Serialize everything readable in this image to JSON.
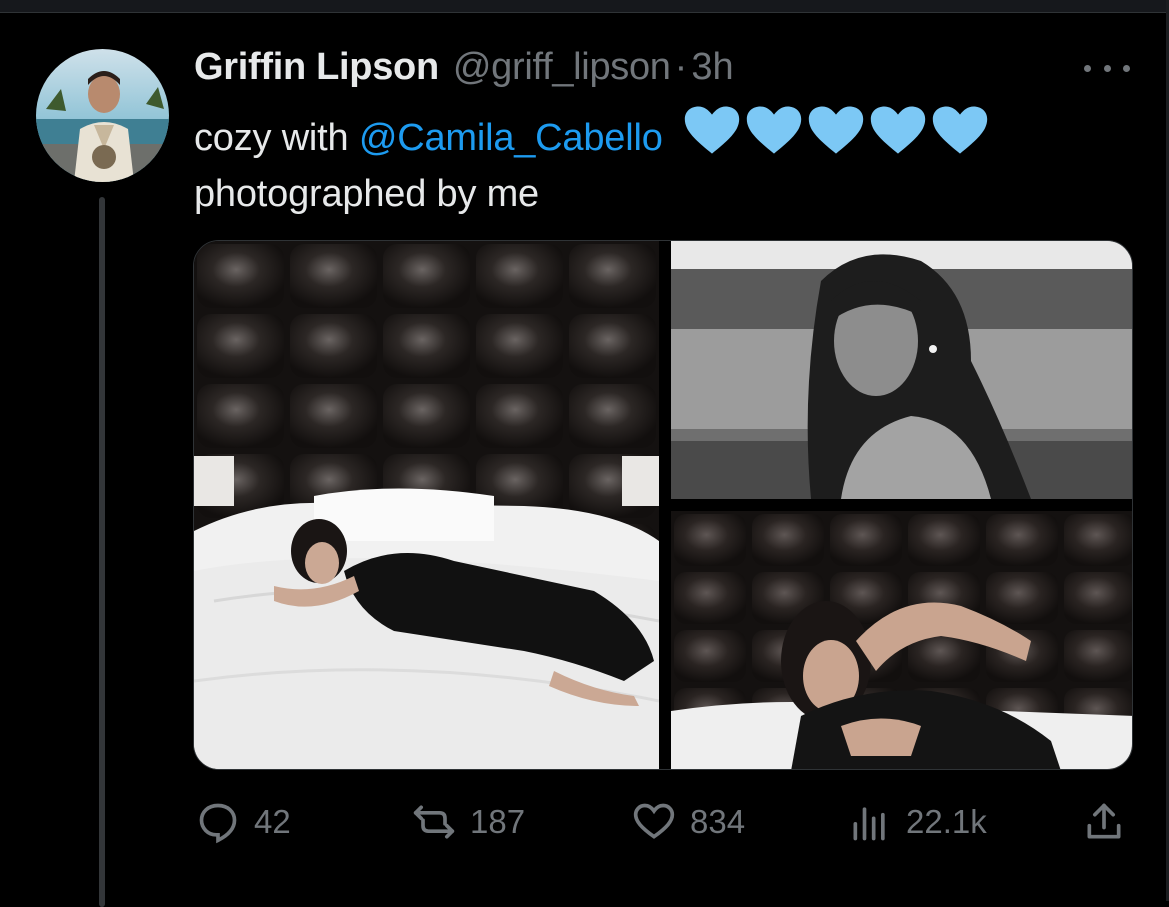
{
  "tweet": {
    "author_name": "Griffin Lipson",
    "handle": "@griff_lipson",
    "separator": "·",
    "time": "3h",
    "text_prefix": "cozy with",
    "mention": "@Camila_Cabello",
    "hearts": [
      "light-blue-heart",
      "light-blue-heart",
      "light-blue-heart",
      "light-blue-heart",
      "light-blue-heart"
    ],
    "text_line2": "photographed by me"
  },
  "media": [
    {
      "name": "bedroom-photo-left",
      "icon": "photo"
    },
    {
      "name": "portrait-photo-top-right",
      "icon": "photo"
    },
    {
      "name": "bedroom-photo-bottom-right",
      "icon": "photo"
    }
  ],
  "actions": {
    "replies": "42",
    "reposts": "187",
    "likes": "834",
    "views": "22.1k"
  },
  "colors": {
    "background": "#000000",
    "text": "#e7e9ea",
    "muted": "#71767b",
    "accent": "#1d9bf0",
    "heart": "#7cc8f5"
  }
}
